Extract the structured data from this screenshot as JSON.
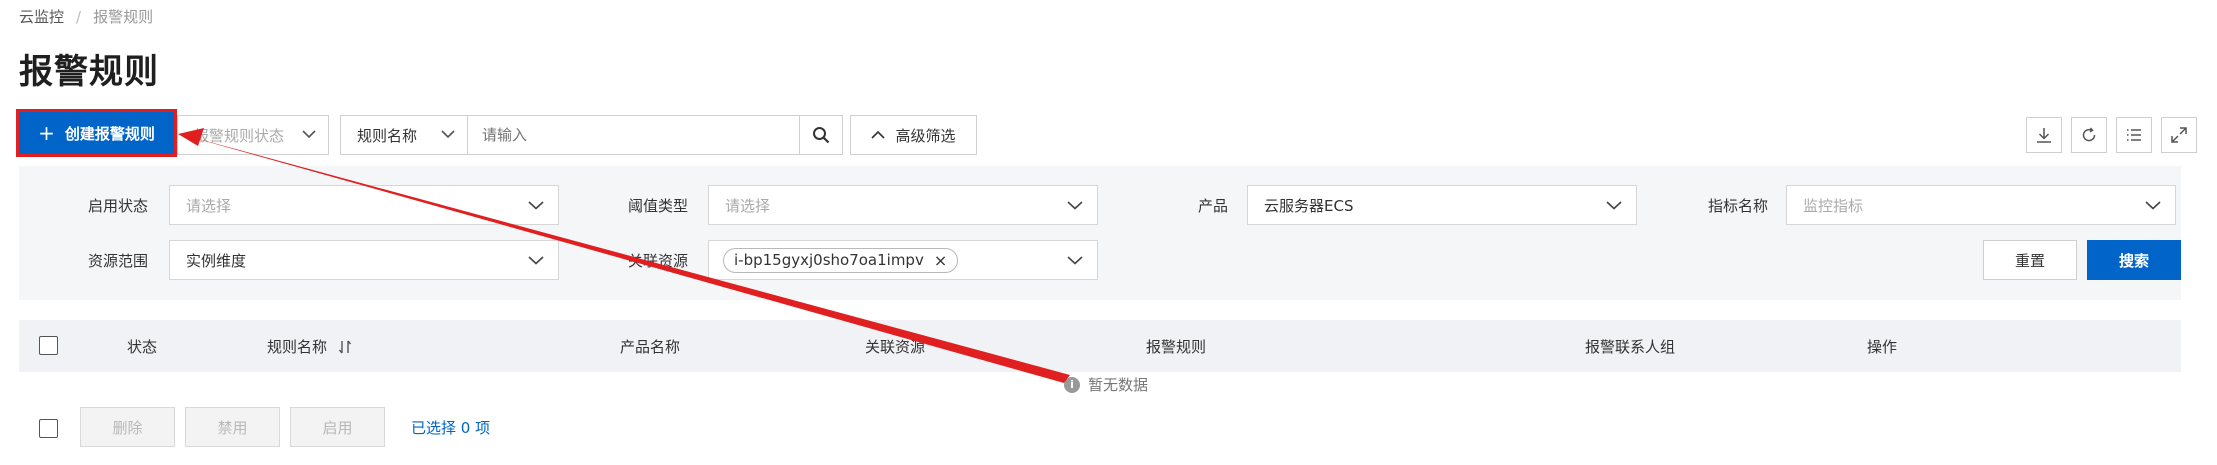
{
  "breadcrumb": {
    "root": "云监控",
    "separator": "/",
    "current": "报警规则"
  },
  "page_title": "报警规则",
  "toolbar": {
    "create_label": "创建报警规则",
    "status_filter_placeholder": "报警规则状态",
    "field_select": "规则名称",
    "search_placeholder": "请输入",
    "advanced_label": "高级筛选"
  },
  "filters": {
    "enable_status": {
      "label": "启用状态",
      "placeholder": "请选择"
    },
    "threshold_type": {
      "label": "阈值类型",
      "placeholder": "请选择"
    },
    "product": {
      "label": "产品",
      "value": "云服务器ECS"
    },
    "metric_name": {
      "label": "指标名称",
      "placeholder": "监控指标"
    },
    "resource_scope": {
      "label": "资源范围",
      "value": "实例维度"
    },
    "related_resources": {
      "label": "关联资源",
      "tag": "i-bp15gyxj0sho7oa1impv"
    },
    "reset_label": "重置",
    "search_label": "搜索"
  },
  "table": {
    "columns": [
      "状态",
      "规则名称",
      "产品名称",
      "关联资源",
      "报警规则",
      "报警联系人组",
      "操作"
    ],
    "empty_text": "暂无数据"
  },
  "footer": {
    "delete_label": "删除",
    "disable_label": "禁用",
    "enable_label": "启用",
    "selected_text": "已选择 0 项"
  },
  "colors": {
    "primary": "#0064c8",
    "annotation_red": "#e02020"
  }
}
